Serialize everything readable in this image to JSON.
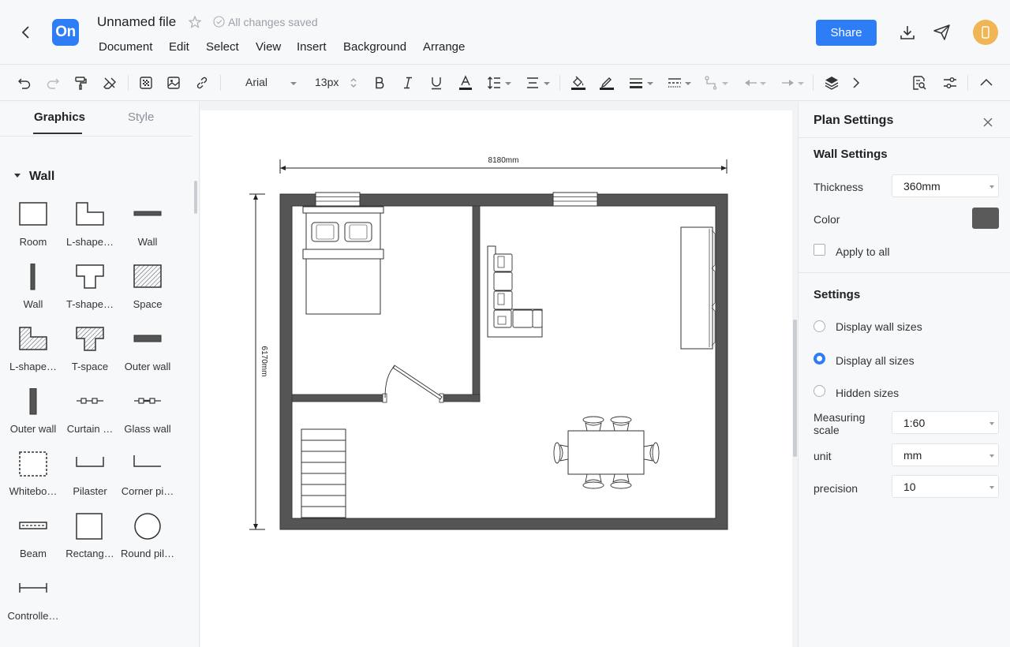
{
  "header": {
    "logo_text": "On",
    "file_title": "Unnamed file",
    "saved_status": "All changes saved",
    "menu": [
      "Document",
      "Edit",
      "Select",
      "View",
      "Insert",
      "Background",
      "Arrange"
    ],
    "share_label": "Share"
  },
  "toolbar": {
    "font_name": "Arial",
    "font_size": "13px",
    "icons": [
      "undo-icon",
      "redo-icon",
      "format-painter-icon",
      "clear-format-icon",
      "fill-pattern-icon",
      "image-icon",
      "link-icon",
      "bold-icon",
      "italic-icon",
      "underline-icon",
      "font-color-icon",
      "line-spacing-icon",
      "align-icon",
      "fill-color-icon",
      "line-color-icon",
      "line-weight-icon",
      "line-style-icon",
      "connector-icon",
      "arrow-start-icon",
      "arrow-end-icon",
      "layers-icon",
      "more-icon",
      "find-replace-icon",
      "settings-icon",
      "collapse-icon"
    ]
  },
  "left_panel": {
    "tabs": {
      "graphics": "Graphics",
      "style": "Style"
    },
    "section_title": "Wall",
    "shapes": [
      {
        "label": "Room",
        "icon": "room-icon"
      },
      {
        "label": "L-shape…",
        "icon": "l-shape-room-icon"
      },
      {
        "label": "Wall",
        "icon": "wall-horizontal-icon"
      },
      {
        "label": "Wall",
        "icon": "wall-vertical-icon"
      },
      {
        "label": "T-shape…",
        "icon": "t-shape-room-icon"
      },
      {
        "label": "Space",
        "icon": "space-icon"
      },
      {
        "label": "L-shape…",
        "icon": "l-shape-space-icon"
      },
      {
        "label": "T-space",
        "icon": "t-space-icon"
      },
      {
        "label": "Outer wall",
        "icon": "outer-wall-horizontal-icon"
      },
      {
        "label": "Outer wall",
        "icon": "outer-wall-vertical-icon"
      },
      {
        "label": "Curtain …",
        "icon": "curtain-wall-icon"
      },
      {
        "label": "Glass wall",
        "icon": "glass-wall-icon"
      },
      {
        "label": "Whitebo…",
        "icon": "whiteboard-wall-icon"
      },
      {
        "label": "Pilaster",
        "icon": "pilaster-icon"
      },
      {
        "label": "Corner pi…",
        "icon": "corner-pilaster-icon"
      },
      {
        "label": "Beam",
        "icon": "beam-icon"
      },
      {
        "label": "Rectang…",
        "icon": "rectangle-pillar-icon"
      },
      {
        "label": "Round pil…",
        "icon": "round-pillar-icon"
      },
      {
        "label": "Controlle…",
        "icon": "controlled-wall-icon"
      }
    ]
  },
  "canvas": {
    "dim_width_label": "8180mm",
    "dim_height_label": "6170mm",
    "wall_color": "#555555"
  },
  "right_panel": {
    "title": "Plan Settings",
    "wall_settings": {
      "heading": "Wall Settings",
      "thickness_label": "Thickness",
      "thickness_value": "360mm",
      "color_label": "Color",
      "color_value": "#5a5a5a",
      "apply_all_label": "Apply to all"
    },
    "settings": {
      "heading": "Settings",
      "radios": [
        {
          "label": "Display wall sizes",
          "selected": false
        },
        {
          "label": "Display all sizes",
          "selected": true
        },
        {
          "label": "Hidden sizes",
          "selected": false
        }
      ],
      "scale_label": "Measuring scale",
      "scale_value": "1:60",
      "unit_label": "unit",
      "unit_value": "mm",
      "precision_label": "precision",
      "precision_value": "10"
    }
  },
  "colors": {
    "accent": "#2d7df6",
    "avatar": "#f0b555"
  }
}
